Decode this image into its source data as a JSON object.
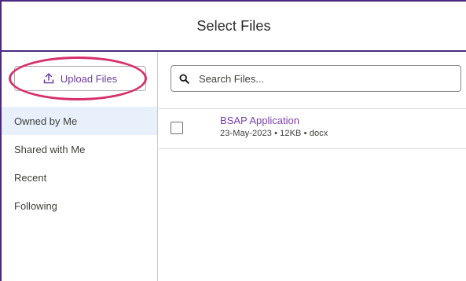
{
  "header": {
    "title": "Select Files"
  },
  "sidebar": {
    "upload_label": "Upload Files",
    "items": [
      {
        "label": "Owned by Me",
        "active": true
      },
      {
        "label": "Shared with Me",
        "active": false
      },
      {
        "label": "Recent",
        "active": false
      },
      {
        "label": "Following",
        "active": false
      }
    ]
  },
  "search": {
    "placeholder": "Search Files...",
    "value": "",
    "icon": "search-icon"
  },
  "files": [
    {
      "name": "BSAP Application",
      "meta": "23-May-2023 • 12KB • docx",
      "checked": false
    }
  ],
  "colors": {
    "frame": "#4b2a80",
    "link": "#7b3fb0",
    "highlight_ring": "#d6306b",
    "active_nav_bg": "#e8f1fb"
  }
}
